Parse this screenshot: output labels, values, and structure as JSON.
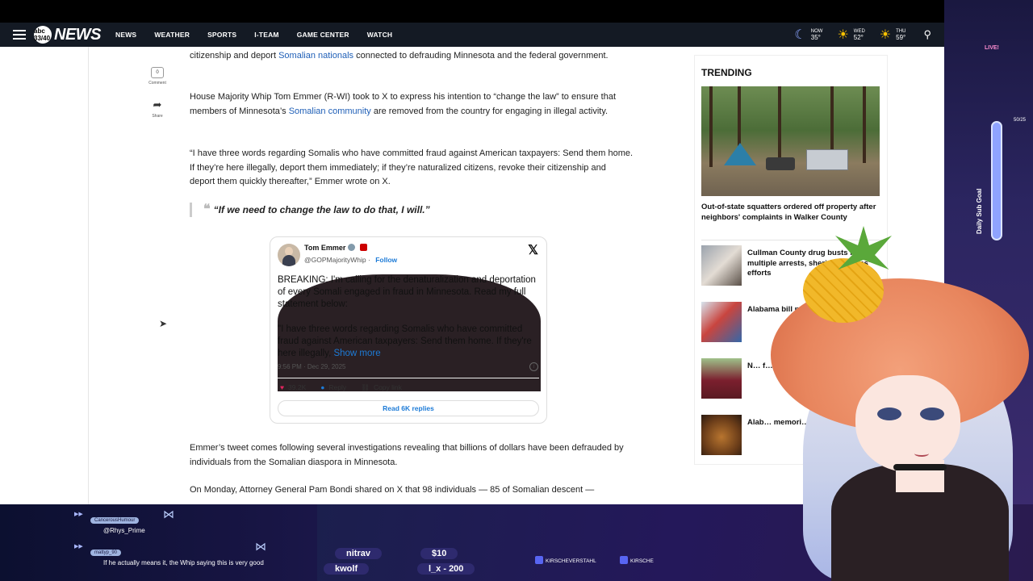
{
  "nav": {
    "logo_small": "abc 33/40",
    "logo": "NEWS",
    "items": [
      "NEWS",
      "WEATHER",
      "SPORTS",
      "I-TEAM",
      "GAME CENTER",
      "WATCH"
    ],
    "weather": [
      {
        "label": "NOW",
        "temp": "35°",
        "icon": "moon-icon"
      },
      {
        "label": "WED",
        "temp": "52°",
        "icon": "sun-icon"
      },
      {
        "label": "THU",
        "temp": "59°",
        "icon": "sun-icon"
      }
    ]
  },
  "social": {
    "comment_count": "0",
    "comment_label": "Comment",
    "share_label": "Share"
  },
  "article": {
    "p1_pre": "citizenship and deport ",
    "p1_link": "Somalian nationals",
    "p1_post": " connected to defrauding Minnesota and the federal government.",
    "p2_pre": "House Majority Whip Tom Emmer (R-WI) took to X to express his intention to “change the law” to ensure that members of Minnesota’s ",
    "p2_link": "Somalian community",
    "p2_post": " are removed from the country for engaging in illegal activity.",
    "p3": "“I have three words regarding Somalis who have committed fraud against American taxpayers: Send them home. If they’re here illegally, deport them immediately; if they’re naturalized citizens, revoke their citizenship and deport them quickly thereafter,” Emmer wrote on X.",
    "quote": "“If we need to change the law to do that, I will.”",
    "p4": "Emmer’s tweet comes following several investigations revealing that billions of dollars have been defrauded by individuals from the Somalian diaspora in Minnesota.",
    "p5": "On Monday, Attorney General Pam Bondi shared on X that 98 individuals — 85 of Somalian descent —"
  },
  "tweet": {
    "name": "Tom Emmer",
    "handle": "@GOPMajorityWhip",
    "follow": "Follow",
    "body1": "BREAKING: I'm calling for the denaturalization and deportation of every Somali engaged in fraud in Minnesota. Read my full statement below:",
    "body2": "\"I have three words regarding Somalis who have committed fraud against American taxpayers: Send them home. If they're here illegally, ",
    "show_more": "Show more",
    "time": "9:56 PM · Dec 29, 2025",
    "likes": "39.2K",
    "reply": "Reply",
    "copy": "Copy link",
    "read_replies": "Read 6K replies"
  },
  "trending": {
    "title": "TRENDING",
    "hero_caption": "Out-of-state squatters ordered off property after neighbors' complaints in Walker County",
    "stories": [
      "Cullman County drug busts le… multiple arrests, sheri… deputies' efforts",
      "Alabama bill p… driver's license",
      "N… f… f…",
      "Alab… memori… claimed"
    ]
  },
  "stream": {
    "chat": [
      {
        "user": "CancerousHumour",
        "text": "@Rhys_Prime"
      },
      {
        "user": "mattyp_90",
        "text": "If he actually means it, the Whip saying this is very good"
      }
    ],
    "ticker": [
      "nitrav",
      "$10",
      "kwolf",
      "l_x - 200"
    ],
    "socials": [
      "KIRSCHEVERSTAHL",
      "KIRSCHE"
    ],
    "sub_goal": "Daily Sub Goal",
    "goal_count": "50/25",
    "live": "LIVE!"
  },
  "colors": {
    "link": "#1f5fb7",
    "nav_bg": "#141a24",
    "twitter_blue": "#1d7bd7",
    "heart": "#e0245e"
  }
}
